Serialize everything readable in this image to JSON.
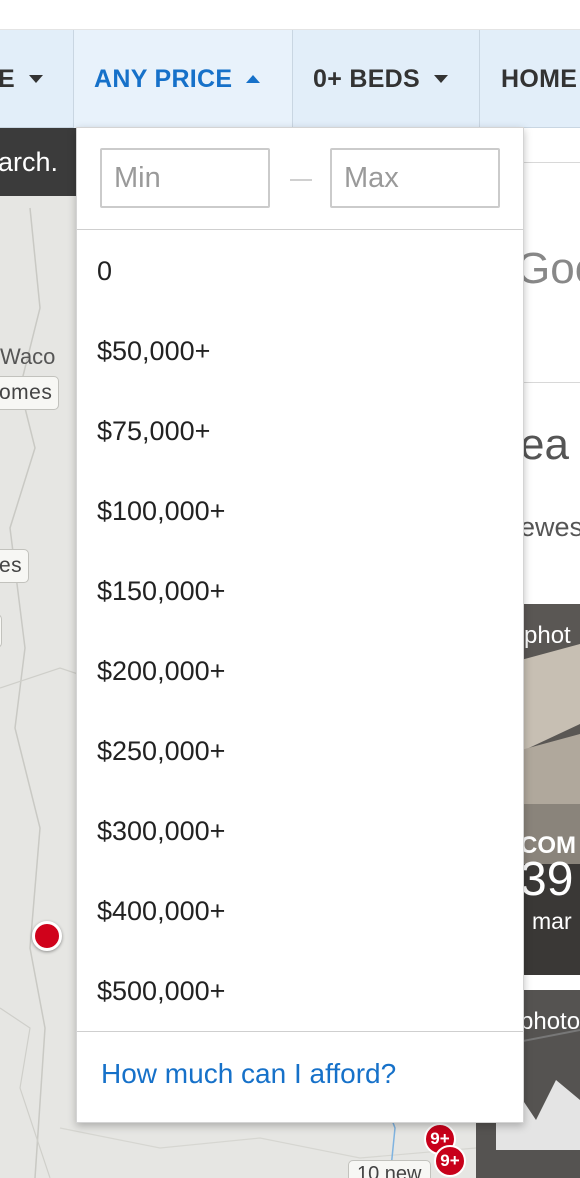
{
  "filter_bar": {
    "type_label_partial": "E",
    "price_label": "ANY PRICE",
    "beds_label": "0+ BEDS",
    "home_label_partial": "HOME"
  },
  "price_dropdown": {
    "min_placeholder": "Min",
    "max_placeholder": "Max",
    "options": [
      "0",
      "$50,000+",
      "$75,000+",
      "$100,000+",
      "$150,000+",
      "$200,000+",
      "$250,000+",
      "$300,000+",
      "$400,000+",
      "$500,000+"
    ],
    "afford_link": "How much can I afford?"
  },
  "map": {
    "search_banner_partial": "arch.",
    "city_partial": "Waco",
    "label_homes_partial": "omes",
    "label_es_partial": "es",
    "cluster_1": "9+",
    "cluster_2": "9+",
    "bottom_label_partial": "10 new"
  },
  "right_panel": {
    "goo_partial": "Goo",
    "heading_partial": "ea",
    "sub_partial": "ewes",
    "card1_photo_partial": "phot",
    "card1_label_partial": "COM",
    "card1_number_partial": "39",
    "card1_sub_partial": "mar",
    "card2_photo_partial": "photo"
  },
  "colors": {
    "accent": "#1671c9",
    "filter_bar_bg": "#e2eef9",
    "map_bg": "#e6e6e3",
    "pin": "#d0021b"
  }
}
